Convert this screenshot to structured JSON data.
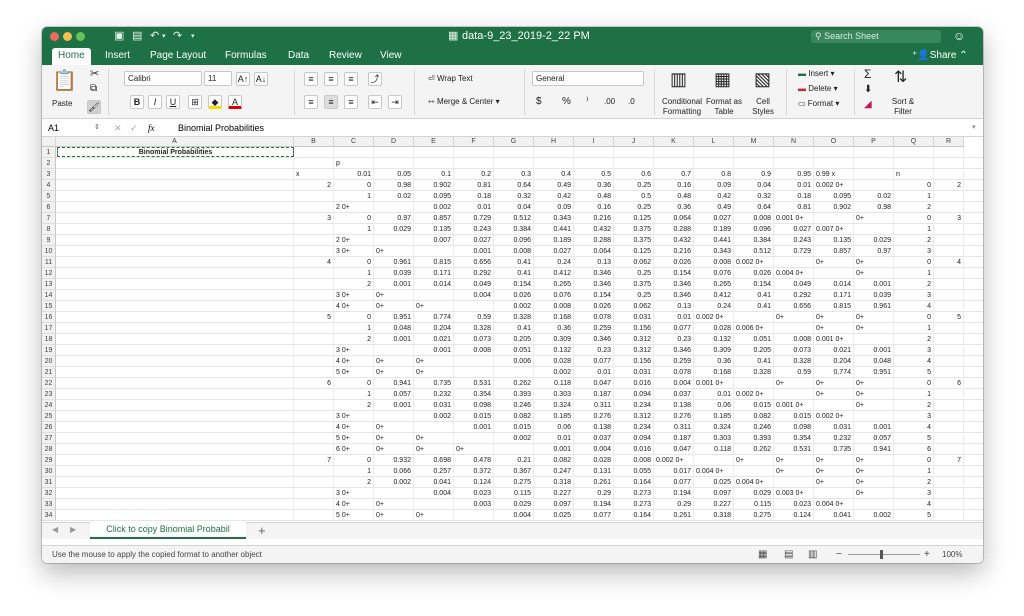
{
  "window": {
    "title": "data-9_23_2019-2_22 PM",
    "search_placeholder": "Search Sheet",
    "share_label": "Share"
  },
  "tabs": [
    "Home",
    "Insert",
    "Page Layout",
    "Formulas",
    "Data",
    "Review",
    "View"
  ],
  "ribbon": {
    "paste": "Paste",
    "font_name": "Calibri",
    "font_size": "11",
    "wrap_text": "Wrap Text",
    "merge_center": "Merge & Center",
    "number_format": "General",
    "currency": "$",
    "percent": "%",
    "comma": "⁾",
    "dec_inc": ".00",
    "dec_dec": ".0",
    "conditional_formatting": "Conditional Formatting",
    "format_as_table": "Format as Table",
    "cell_styles": "Cell Styles",
    "insert": "Insert",
    "delete": "Delete",
    "format": "Format",
    "sort_filter": "Sort & Filter",
    "bold": "B",
    "italic": "I",
    "underline": "U"
  },
  "formula_bar": {
    "cell_ref": "A1",
    "fx": "fx",
    "content": "Binomial Probabilities"
  },
  "columns": [
    "A",
    "B",
    "C",
    "D",
    "E",
    "F",
    "G",
    "H",
    "I",
    "J",
    "K",
    "L",
    "M",
    "N",
    "O",
    "P",
    "Q",
    "R"
  ],
  "rows": [
    [
      "Binomial Probabilities",
      "",
      "",
      "",
      "",
      "",
      "",
      "",
      "",
      "",
      "",
      "",
      "",
      "",
      "",
      "",
      "",
      ""
    ],
    [
      "",
      "",
      "p",
      "",
      "",
      "",
      "",
      "",
      "",
      "",
      "",
      "",
      "",
      "",
      "",
      "",
      "",
      ""
    ],
    [
      "",
      "x",
      "0.01",
      "0.05",
      "0.1",
      "0.2",
      "0.3",
      "0.4",
      "0.5",
      "0.6",
      "0.7",
      "0.8",
      "0.9",
      "0.95",
      "0.99 x",
      "",
      "n",
      ""
    ],
    [
      "",
      "2",
      "0",
      "0.98",
      "0.902",
      "0.81",
      "0.64",
      "0.49",
      "0.36",
      "0.25",
      "0.16",
      "0.09",
      "0.04",
      "0.01",
      "0.002 0+",
      "",
      "0",
      "2"
    ],
    [
      "",
      "",
      "1",
      "0.02",
      "0.095",
      "0.18",
      "0.32",
      "0.42",
      "0.48",
      "0.5",
      "0.48",
      "0.42",
      "0.32",
      "0.18",
      "0.095",
      "0.02",
      "1",
      ""
    ],
    [
      "",
      "",
      "2 0+",
      "",
      "0.002",
      "0.01",
      "0.04",
      "0.09",
      "0.16",
      "0.25",
      "0.36",
      "0.49",
      "0.64",
      "0.81",
      "0.902",
      "0.98",
      "2",
      ""
    ],
    [
      "",
      "3",
      "0",
      "0.97",
      "0.857",
      "0.729",
      "0.512",
      "0.343",
      "0.216",
      "0.125",
      "0.064",
      "0.027",
      "0.008",
      "0.001 0+",
      "",
      "0+",
      "0",
      "3"
    ],
    [
      "",
      "",
      "1",
      "0.029",
      "0.135",
      "0.243",
      "0.384",
      "0.441",
      "0.432",
      "0.375",
      "0.288",
      "0.189",
      "0.096",
      "0.027",
      "0.007 0+",
      "",
      "1",
      ""
    ],
    [
      "",
      "",
      "2 0+",
      "",
      "0.007",
      "0.027",
      "0.096",
      "0.189",
      "0.288",
      "0.375",
      "0.432",
      "0.441",
      "0.384",
      "0.243",
      "0.135",
      "0.029",
      "2",
      ""
    ],
    [
      "",
      "",
      "3 0+",
      "0+",
      "",
      "0.001",
      "0.008",
      "0.027",
      "0.064",
      "0.125",
      "0.216",
      "0.343",
      "0.512",
      "0.729",
      "0.857",
      "0.97",
      "3",
      ""
    ],
    [
      "",
      "4",
      "0",
      "0.961",
      "0.815",
      "0.656",
      "0.41",
      "0.24",
      "0.13",
      "0.062",
      "0.026",
      "0.008",
      "0.002 0+",
      "",
      "0+",
      "0+",
      "0",
      "4"
    ],
    [
      "",
      "",
      "1",
      "0.039",
      "0.171",
      "0.292",
      "0.41",
      "0.412",
      "0.346",
      "0.25",
      "0.154",
      "0.076",
      "0.026",
      "0.004 0+",
      "",
      "0+",
      "1",
      ""
    ],
    [
      "",
      "",
      "2",
      "0.001",
      "0.014",
      "0.049",
      "0.154",
      "0.265",
      "0.346",
      "0.375",
      "0.346",
      "0.265",
      "0.154",
      "0.049",
      "0.014",
      "0.001",
      "2",
      ""
    ],
    [
      "",
      "",
      "3 0+",
      "0+",
      "",
      "0.004",
      "0.026",
      "0.076",
      "0.154",
      "0.25",
      "0.346",
      "0.412",
      "0.41",
      "0.292",
      "0.171",
      "0.039",
      "3",
      ""
    ],
    [
      "",
      "",
      "4 0+",
      "0+",
      "0+",
      "",
      "0.002",
      "0.008",
      "0.026",
      "0.062",
      "0.13",
      "0.24",
      "0.41",
      "0.656",
      "0.815",
      "0.961",
      "4",
      ""
    ],
    [
      "",
      "5",
      "0",
      "0.951",
      "0.774",
      "0.59",
      "0.328",
      "0.168",
      "0.078",
      "0.031",
      "0.01",
      "0.002 0+",
      "",
      "0+",
      "0+",
      "0+",
      "0",
      "5"
    ],
    [
      "",
      "",
      "1",
      "0.048",
      "0.204",
      "0.328",
      "0.41",
      "0.36",
      "0.259",
      "0.156",
      "0.077",
      "0.028",
      "0.006 0+",
      "",
      "0+",
      "0+",
      "1",
      ""
    ],
    [
      "",
      "",
      "2",
      "0.001",
      "0.021",
      "0.073",
      "0.205",
      "0.309",
      "0.346",
      "0.312",
      "0.23",
      "0.132",
      "0.051",
      "0.008",
      "0.001 0+",
      "",
      "2",
      ""
    ],
    [
      "",
      "",
      "3 0+",
      "",
      "0.001",
      "0.008",
      "0.051",
      "0.132",
      "0.23",
      "0.312",
      "0.346",
      "0.309",
      "0.205",
      "0.073",
      "0.021",
      "0.001",
      "3",
      ""
    ],
    [
      "",
      "",
      "4 0+",
      "0+",
      "0+",
      "",
      "0.006",
      "0.028",
      "0.077",
      "0.156",
      "0.259",
      "0.36",
      "0.41",
      "0.328",
      "0.204",
      "0.048",
      "4",
      ""
    ],
    [
      "",
      "",
      "5 0+",
      "0+",
      "0+",
      "",
      "",
      "0.002",
      "0.01",
      "0.031",
      "0.078",
      "0.168",
      "0.328",
      "0.59",
      "0.774",
      "0.951",
      "5",
      ""
    ],
    [
      "",
      "6",
      "0",
      "0.941",
      "0.735",
      "0.531",
      "0.262",
      "0.118",
      "0.047",
      "0.016",
      "0.004",
      "0.001 0+",
      "",
      "0+",
      "0+",
      "0+",
      "0",
      "6"
    ],
    [
      "",
      "",
      "1",
      "0.057",
      "0.232",
      "0.354",
      "0.393",
      "0.303",
      "0.187",
      "0.094",
      "0.037",
      "0.01",
      "0.002 0+",
      "",
      "0+",
      "0+",
      "1",
      ""
    ],
    [
      "",
      "",
      "2",
      "0.001",
      "0.031",
      "0.098",
      "0.246",
      "0.324",
      "0.311",
      "0.234",
      "0.138",
      "0.06",
      "0.015",
      "0.001 0+",
      "",
      "0+",
      "2",
      ""
    ],
    [
      "",
      "",
      "3 0+",
      "",
      "0.002",
      "0.015",
      "0.082",
      "0.185",
      "0.276",
      "0.312",
      "0.276",
      "0.185",
      "0.082",
      "0.015",
      "0.002 0+",
      "",
      "3",
      ""
    ],
    [
      "",
      "",
      "4 0+",
      "0+",
      "",
      "0.001",
      "0.015",
      "0.06",
      "0.138",
      "0.234",
      "0.311",
      "0.324",
      "0.246",
      "0.098",
      "0.031",
      "0.001",
      "4",
      ""
    ],
    [
      "",
      "",
      "5 0+",
      "0+",
      "0+",
      "",
      "0.002",
      "0.01",
      "0.037",
      "0.094",
      "0.187",
      "0.303",
      "0.393",
      "0.354",
      "0.232",
      "0.057",
      "5",
      ""
    ],
    [
      "",
      "",
      "6 0+",
      "0+",
      "0+",
      "0+",
      "",
      "0.001",
      "0.004",
      "0.016",
      "0.047",
      "0.118",
      "0.262",
      "0.531",
      "0.735",
      "0.941",
      "6",
      ""
    ],
    [
      "",
      "7",
      "0",
      "0.932",
      "0.698",
      "0.478",
      "0.21",
      "0.082",
      "0.028",
      "0.008",
      "0.002 0+",
      "",
      "0+",
      "0+",
      "0+",
      "0+",
      "0",
      "7"
    ],
    [
      "",
      "",
      "1",
      "0.066",
      "0.257",
      "0.372",
      "0.367",
      "0.247",
      "0.131",
      "0.055",
      "0.017",
      "0.004 0+",
      "",
      "0+",
      "0+",
      "0+",
      "1",
      ""
    ],
    [
      "",
      "",
      "2",
      "0.002",
      "0.041",
      "0.124",
      "0.275",
      "0.318",
      "0.261",
      "0.164",
      "0.077",
      "0.025",
      "0.004 0+",
      "",
      "0+",
      "0+",
      "2",
      ""
    ],
    [
      "",
      "",
      "3 0+",
      "",
      "0.004",
      "0.023",
      "0.115",
      "0.227",
      "0.29",
      "0.273",
      "0.194",
      "0.097",
      "0.029",
      "0.003 0+",
      "",
      "0+",
      "3",
      ""
    ],
    [
      "",
      "",
      "4 0+",
      "0+",
      "",
      "0.003",
      "0.029",
      "0.097",
      "0.194",
      "0.273",
      "0.29",
      "0.227",
      "0.115",
      "0.023",
      "0.004 0+",
      "",
      "4",
      ""
    ],
    [
      "",
      "",
      "5 0+",
      "0+",
      "0+",
      "",
      "0.004",
      "0.025",
      "0.077",
      "0.164",
      "0.261",
      "0.318",
      "0.275",
      "0.124",
      "0.041",
      "0.002",
      "5",
      ""
    ]
  ],
  "sheet_tab": "Click to copy Binomial Probabil",
  "status": {
    "message": "Use the mouse to apply the copied format to another object",
    "zoom": "100%"
  },
  "colors": {
    "accent": "#1e7145"
  }
}
